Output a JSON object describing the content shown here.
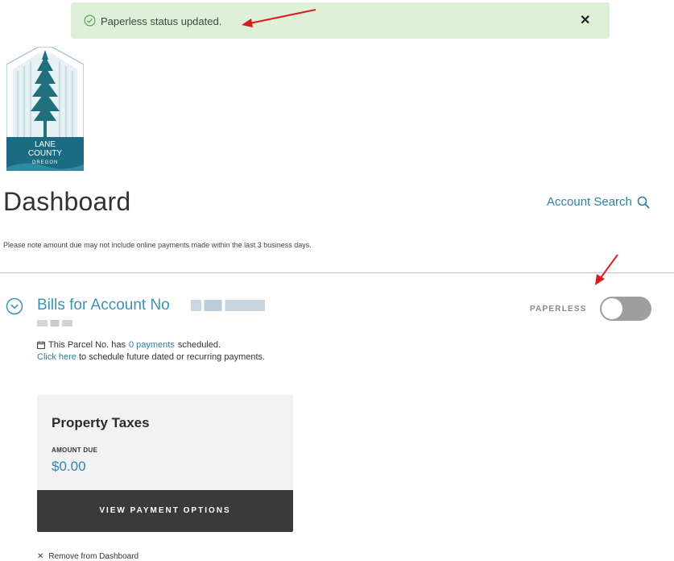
{
  "toast": {
    "message": "Paperless status updated.",
    "close_glyph": "✕",
    "bg": "#dff0d8"
  },
  "logo": {
    "line1": "LANE",
    "line2": "COUNTY",
    "line3": "OREGON"
  },
  "header": {
    "title": "Dashboard",
    "account_search": "Account Search"
  },
  "note": "Please note amount due may not include online payments made within the last 3 business days.",
  "account": {
    "bills_title": "Bills for Account No",
    "paperless_label": "PAPERLESS",
    "paperless_enabled": false,
    "sched_prefix": "This Parcel No. has",
    "sched_link": "0 payments",
    "sched_suffix": "scheduled.",
    "click_link": "Click here",
    "click_suffix": "to schedule future dated or recurring payments."
  },
  "card": {
    "title": "Property Taxes",
    "amount_label": "AMOUNT DUE",
    "amount_value": "$0.00",
    "button": "VIEW PAYMENT OPTIONS"
  },
  "remove": {
    "glyph": "✕",
    "label": "Remove from Dashboard"
  },
  "colors": {
    "accent": "#2e7fa5",
    "annotation_red": "#d91c1c"
  }
}
